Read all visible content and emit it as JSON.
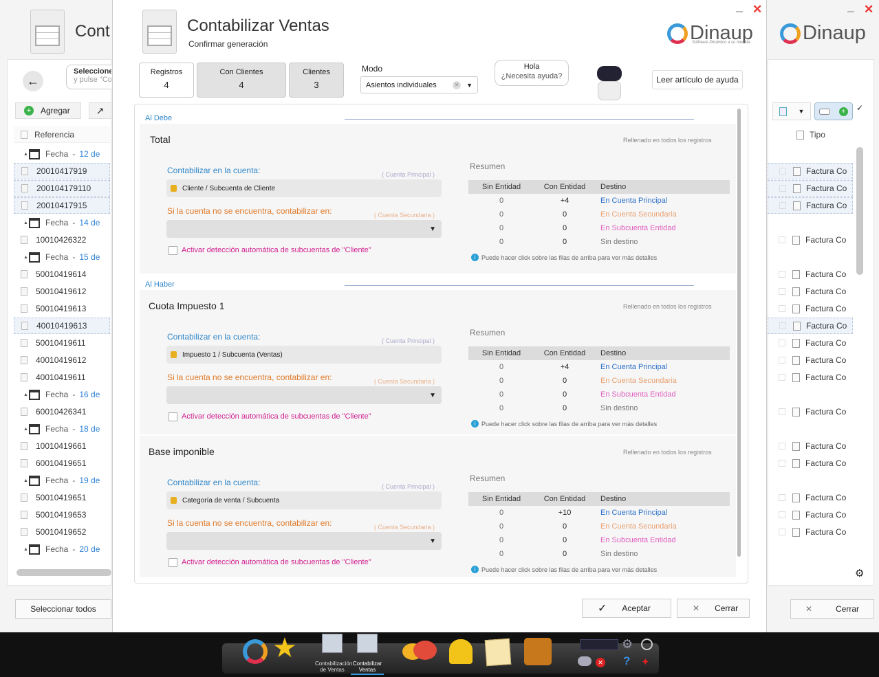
{
  "background_window": {
    "title_partial": "Cont",
    "search_placeholder": "Seleccione",
    "search_sub": "y pulse \"Co",
    "add_button": "Agregar",
    "col_referencia": "Referencia",
    "col_tipo": "Tipo",
    "select_all": "Seleccionar todos",
    "close": "Cerrar",
    "brand": "Dinaup",
    "brand_tag": "Software Dinámico a su medida",
    "rows": [
      {
        "kind": "group",
        "label": "Fecha",
        "date": "12 de"
      },
      {
        "kind": "row",
        "ref": "20010417919",
        "sel": true
      },
      {
        "kind": "row",
        "ref": "200104179110",
        "sel": true
      },
      {
        "kind": "row",
        "ref": "20010417915",
        "sel": true
      },
      {
        "kind": "group",
        "label": "Fecha",
        "date": "14 de"
      },
      {
        "kind": "row",
        "ref": "10010426322"
      },
      {
        "kind": "group",
        "label": "Fecha",
        "date": "15 de"
      },
      {
        "kind": "row",
        "ref": "50010419614"
      },
      {
        "kind": "row",
        "ref": "50010419612"
      },
      {
        "kind": "row",
        "ref": "50010419613"
      },
      {
        "kind": "row",
        "ref": "40010419613",
        "sel": true
      },
      {
        "kind": "row",
        "ref": "50010419611"
      },
      {
        "kind": "row",
        "ref": "40010419612"
      },
      {
        "kind": "row",
        "ref": "40010419611"
      },
      {
        "kind": "group",
        "label": "Fecha",
        "date": "16 de"
      },
      {
        "kind": "row",
        "ref": "60010426341"
      },
      {
        "kind": "group",
        "label": "Fecha",
        "date": "18 de"
      },
      {
        "kind": "row",
        "ref": "10010419661"
      },
      {
        "kind": "row",
        "ref": "60010419651"
      },
      {
        "kind": "group",
        "label": "Fecha",
        "date": "19 de"
      },
      {
        "kind": "row",
        "ref": "50010419651"
      },
      {
        "kind": "row",
        "ref": "50010419653"
      },
      {
        "kind": "row",
        "ref": "50010419652"
      },
      {
        "kind": "group",
        "label": "Fecha",
        "date": "20 de"
      }
    ],
    "right_type": "Factura Co"
  },
  "dialog": {
    "title": "Contabilizar Ventas",
    "subtitle": "Confirmar generación",
    "brand": "Dinaup",
    "brand_tag": "Software Dinámico a su medida",
    "stats": [
      {
        "label": "Registros",
        "value": "4"
      },
      {
        "label": "Con Clientes",
        "value": "4"
      },
      {
        "label": "Clientes",
        "value": "3"
      }
    ],
    "mode_label": "Modo",
    "mode_value": "Asientos individuales",
    "help_bubble_1": "Hola",
    "help_bubble_2": "¿Necesita ayuda?",
    "help_button": "Leer artículo de ayuda",
    "al_debe": "Al Debe",
    "al_haber": "Al Haber",
    "filled_note": "Rellenado en todos los registros",
    "account_label": "Contabilizar en la cuenta:",
    "account_hint": "( Cuenta Principal )",
    "fallback_label": "Si la cuenta no se encuentra, contabilizar en:",
    "fallback_hint": "( Cuenta Secundaria )",
    "auto_detect": "Activar detección automática de subcuentas de \"Cliente\"",
    "resumen": "Resumen",
    "col_sin": "Sin Entidad",
    "col_con": "Con Entidad",
    "col_dest": "Destino",
    "dest": [
      "En Cuenta Principal",
      "En Cuenta Secundaria",
      "En Subcuenta Entidad",
      "Sin destino"
    ],
    "info": "Puede hacer click sobre las filas de arriba para ver más detalles",
    "sections": [
      {
        "title": "Total",
        "account": "Cliente / Subcuenta de Cliente",
        "rows": [
          [
            "0",
            "+4"
          ],
          [
            "0",
            "0"
          ],
          [
            "0",
            "0"
          ],
          [
            "0",
            "0"
          ]
        ]
      },
      {
        "title": "Cuota Impuesto 1",
        "account": "Impuesto 1 / Subcuenta (Ventas)",
        "rows": [
          [
            "0",
            "+4"
          ],
          [
            "0",
            "0"
          ],
          [
            "0",
            "0"
          ],
          [
            "0",
            "0"
          ]
        ]
      },
      {
        "title": "Base imponible",
        "account": "Categoría de venta / Subcuenta",
        "rows": [
          [
            "0",
            "+10"
          ],
          [
            "0",
            "0"
          ],
          [
            "0",
            "0"
          ],
          [
            "0",
            "0"
          ]
        ]
      }
    ],
    "accept": "Aceptar",
    "close": "Cerrar"
  },
  "taskbar": {
    "item1": "Contabilización de Ventas",
    "item2": "Contabilizar Ventas"
  }
}
